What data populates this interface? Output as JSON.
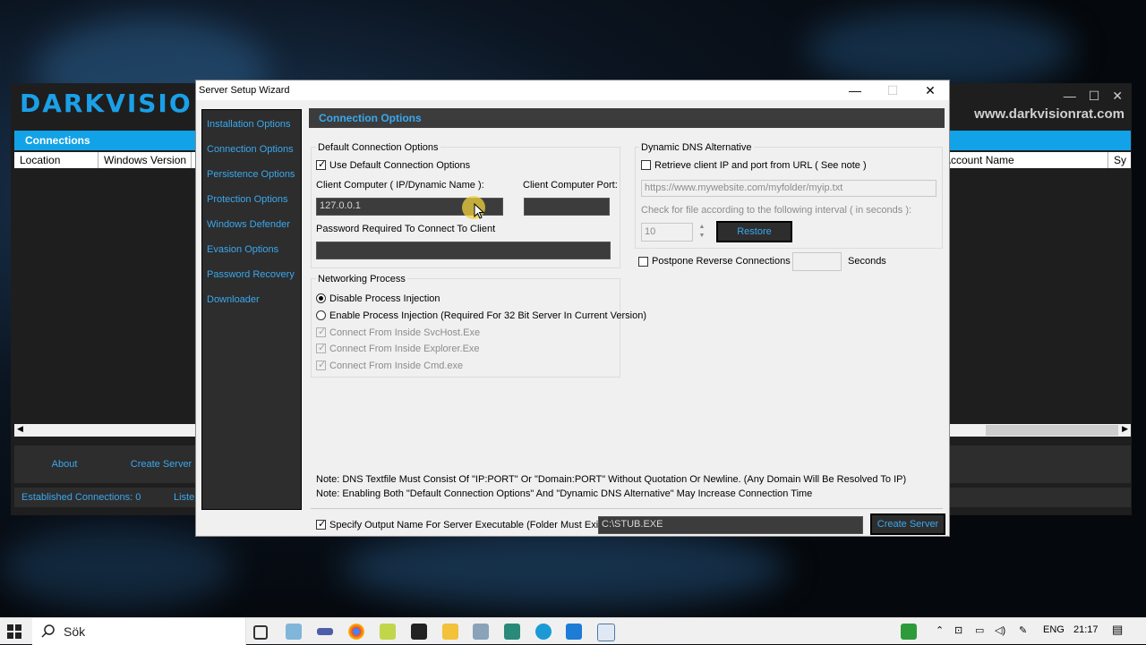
{
  "background_app": {
    "logo": "DARKVISIO",
    "website": "www.darkvisionrat.com",
    "window_buttons": [
      "—",
      "☐",
      "✕"
    ],
    "connections_label": "Connections",
    "columns": [
      "Location",
      "Windows Version",
      "Account Name",
      "Sy"
    ],
    "about_button": "About",
    "create_server_button": "Create Server",
    "status_established": "Established Connections: 0",
    "status_listening": "Listeni"
  },
  "dialog": {
    "title": "Server Setup Wizard",
    "window_buttons": {
      "minimize": "—",
      "maximize": "☐",
      "close": "✕"
    },
    "nav": [
      "Installation Options",
      "Connection Options",
      "Persistence Options",
      "Protection Options",
      "Windows Defender",
      "Evasion Options",
      "Password Recovery",
      "Downloader"
    ],
    "section_header": "Connection Options",
    "default_group": {
      "title": "Default Connection Options",
      "use_default_label": "Use Default  Connection Options",
      "use_default_checked": true,
      "client_computer_label": "Client Computer ( IP/Dynamic Name ):",
      "client_computer_value": "127.0.0.1",
      "client_port_label": "Client Computer Port:",
      "client_port_value": "",
      "password_label": "Password Required To Connect To Client",
      "password_value": ""
    },
    "networking_group": {
      "title": "Networking Process",
      "disable_injection": "Disable Process Injection",
      "enable_injection": "Enable Process Injection (Required For 32 Bit Server In Current Version)",
      "svchost": "Connect From Inside SvcHost.Exe",
      "explorer": "Connect From Inside Explorer.Exe",
      "cmd": "Connect From Inside Cmd.exe",
      "selected": "disable"
    },
    "dns_group": {
      "title": "Dynamic DNS Alternative",
      "retrieve_label": "Retrieve client IP and port from URL ( See note )",
      "retrieve_checked": false,
      "url_value": "https://www.mywebsite.com/myfolder/myip.txt",
      "interval_label": "Check for file according to the following interval ( in seconds ):",
      "interval_value": "10",
      "restore_button": "Restore"
    },
    "postpone": {
      "label": "Postpone Reverse Connections",
      "checked": false,
      "value": "",
      "unit": "Seconds"
    },
    "notes": [
      "Note: DNS Textfile Must Consist Of \"IP:PORT\" Or \"Domain:PORT\" Without Quotation Or Newline. (Any Domain Will Be Resolved To IP)",
      "Note: Enabling Both \"Default Connection Options\" And \"Dynamic DNS Alternative\" May Increase Connection Time"
    ],
    "output": {
      "label": "Specify Output Name For Server Executable (Folder Must Exist):",
      "checked": true,
      "value": "C:\\STUB.EXE",
      "create_button": "Create Server"
    }
  },
  "taskbar": {
    "search_text": "Sök",
    "language": "ENG",
    "time": "21:17"
  },
  "colors": {
    "accent": "#3aa8ee",
    "header_bar": "#12a2e8",
    "dark_panel": "#2d2d2d"
  }
}
